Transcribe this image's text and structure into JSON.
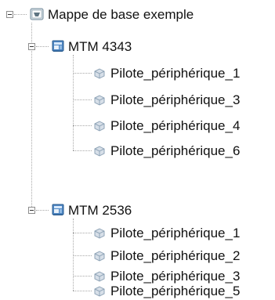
{
  "tree": {
    "root": {
      "label": "Mappe de base exemple",
      "icon": "map-icon",
      "expanded": true
    },
    "groups": [
      {
        "label": "MTM 4343",
        "icon": "machine-type-icon",
        "expanded": true,
        "children": [
          {
            "label": "Pilote_périphérique_1",
            "icon": "device-driver-icon"
          },
          {
            "label": "Pilote_périphérique_3",
            "icon": "device-driver-icon"
          },
          {
            "label": "Pilote_périphérique_4",
            "icon": "device-driver-icon"
          },
          {
            "label": "Pilote_périphérique_6",
            "icon": "device-driver-icon"
          }
        ]
      },
      {
        "label": "MTM 2536",
        "icon": "machine-type-icon",
        "expanded": true,
        "children": [
          {
            "label": "Pilote_périphérique_1",
            "icon": "device-driver-icon"
          },
          {
            "label": "Pilote_périphérique_2",
            "icon": "device-driver-icon"
          },
          {
            "label": "Pilote_périphérique_3",
            "icon": "device-driver-icon"
          },
          {
            "label": "Pilote_périphérique_5",
            "icon": "device-driver-icon"
          }
        ]
      }
    ]
  }
}
